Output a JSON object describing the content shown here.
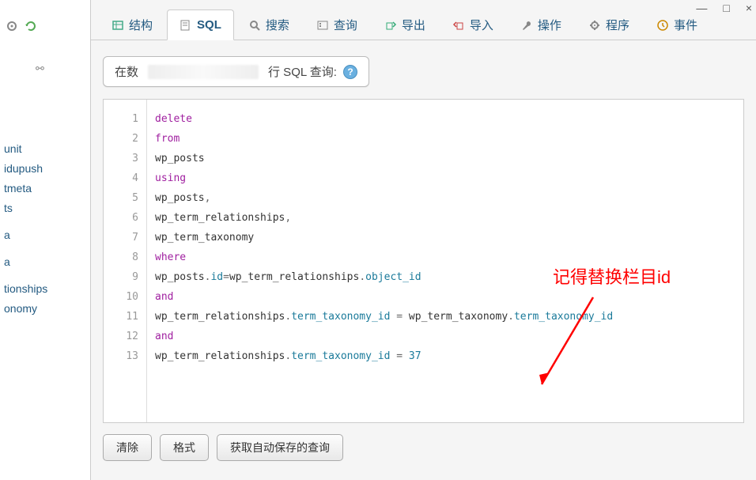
{
  "window_controls": {
    "minimize": "—",
    "maximize": "□",
    "close": "×"
  },
  "sidebar": {
    "items": [
      "unit",
      "idupush",
      "tmeta",
      "ts",
      "",
      "a",
      "",
      "a",
      "",
      "tionships",
      "onomy",
      ""
    ]
  },
  "tabs": [
    {
      "label": "结构",
      "icon": "structure"
    },
    {
      "label": "SQL",
      "icon": "sql",
      "active": true
    },
    {
      "label": "搜索",
      "icon": "search"
    },
    {
      "label": "查询",
      "icon": "query"
    },
    {
      "label": "导出",
      "icon": "export"
    },
    {
      "label": "导入",
      "icon": "import"
    },
    {
      "label": "操作",
      "icon": "wrench"
    },
    {
      "label": "程序",
      "icon": "gear"
    },
    {
      "label": "事件",
      "icon": "events"
    }
  ],
  "query_label": {
    "prefix": "在数",
    "suffix": "行 SQL 查询:"
  },
  "code": {
    "lines": [
      {
        "n": 1,
        "tokens": [
          {
            "t": "delete",
            "c": "kw"
          }
        ]
      },
      {
        "n": 2,
        "tokens": [
          {
            "t": "from",
            "c": "kw"
          }
        ]
      },
      {
        "n": 3,
        "tokens": [
          {
            "t": "wp_posts",
            "c": "tbl"
          }
        ]
      },
      {
        "n": 4,
        "tokens": [
          {
            "t": "using",
            "c": "kw"
          }
        ]
      },
      {
        "n": 5,
        "tokens": [
          {
            "t": "wp_posts",
            "c": "tbl"
          },
          {
            "t": ",",
            "c": "op"
          }
        ]
      },
      {
        "n": 6,
        "tokens": [
          {
            "t": "wp_term_relationships",
            "c": "tbl"
          },
          {
            "t": ",",
            "c": "op"
          }
        ]
      },
      {
        "n": 7,
        "tokens": [
          {
            "t": "wp_term_taxonomy",
            "c": "tbl"
          }
        ]
      },
      {
        "n": 8,
        "tokens": [
          {
            "t": "where",
            "c": "kw"
          }
        ]
      },
      {
        "n": 9,
        "tokens": [
          {
            "t": "wp_posts",
            "c": "tbl"
          },
          {
            "t": ".",
            "c": "op"
          },
          {
            "t": "id",
            "c": "col"
          },
          {
            "t": "=",
            "c": "op"
          },
          {
            "t": "wp_term_relationships",
            "c": "tbl"
          },
          {
            "t": ".",
            "c": "op"
          },
          {
            "t": "object_id",
            "c": "col"
          }
        ]
      },
      {
        "n": 10,
        "tokens": [
          {
            "t": "and",
            "c": "kw"
          }
        ]
      },
      {
        "n": 11,
        "tokens": [
          {
            "t": "wp_term_relationships",
            "c": "tbl"
          },
          {
            "t": ".",
            "c": "op"
          },
          {
            "t": "term_taxonomy_id",
            "c": "col"
          },
          {
            "t": " = ",
            "c": "op"
          },
          {
            "t": "wp_term_taxonomy",
            "c": "tbl"
          },
          {
            "t": ".",
            "c": "op"
          },
          {
            "t": "term_taxonomy_id",
            "c": "col"
          }
        ]
      },
      {
        "n": 12,
        "tokens": [
          {
            "t": "and",
            "c": "kw"
          }
        ]
      },
      {
        "n": 13,
        "tokens": [
          {
            "t": "wp_term_relationships",
            "c": "tbl"
          },
          {
            "t": ".",
            "c": "op"
          },
          {
            "t": "term_taxonomy_id",
            "c": "col"
          },
          {
            "t": " = ",
            "c": "op"
          },
          {
            "t": "37",
            "c": "num"
          }
        ]
      }
    ]
  },
  "buttons": {
    "clear": "清除",
    "format": "格式",
    "autosave": "获取自动保存的查询"
  },
  "annotation": "记得替换栏目id",
  "help_tooltip": "?"
}
